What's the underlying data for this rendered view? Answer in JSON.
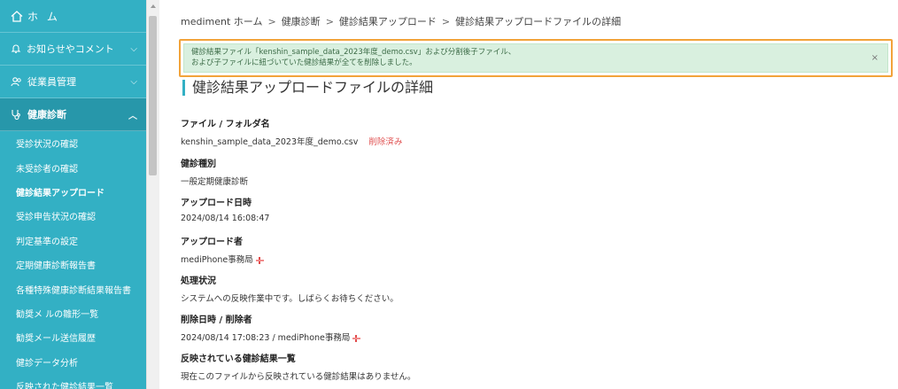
{
  "sidebar": {
    "home_label": "ホ ム",
    "sections": [
      {
        "label": "お知らせやコメント",
        "icon": "bell-icon"
      },
      {
        "label": "従業員管理",
        "icon": "users-icon"
      },
      {
        "label": "健康診断",
        "icon": "stethoscope-icon"
      }
    ],
    "sub_items": [
      {
        "label": "受診状況の確認"
      },
      {
        "label": "未受診者の確認"
      },
      {
        "label": "健診結果アップロード"
      },
      {
        "label": "受診申告状況の確認"
      },
      {
        "label": "判定基準の設定"
      },
      {
        "label": "定期健康診断報告書"
      },
      {
        "label": "各種特殊健康診断結果報告書"
      },
      {
        "label": "勧奨メ ルの雛形一覧"
      },
      {
        "label": "勧奨メール送信履歴"
      },
      {
        "label": "健診データ分析"
      },
      {
        "label": "反映された健診結果一覧"
      }
    ]
  },
  "breadcrumb": {
    "items": [
      "mediment ホーム",
      "健康診断",
      "健診結果アップロード",
      "健診結果アップロードファイルの詳細"
    ],
    "separator": ">"
  },
  "alert": {
    "line1": "健診結果ファイル「kenshin_sample_data_2023年度_demo.csv」および分割後子ファイル、",
    "line2": "および子ファイルに紐づいていた健診結果が全てを削除しました。",
    "close": "×"
  },
  "page": {
    "title": "健診結果アップロードファイルの詳細"
  },
  "fields": {
    "file": {
      "label": "ファイル / フォルダ名",
      "value": "kenshin_sample_data_2023年度_demo.csv",
      "status": "削除済み"
    },
    "type": {
      "label": "健診種別",
      "value": "一般定期健康診断"
    },
    "upload_time": {
      "label": "アップロード日時",
      "value": "2024/08/14 16:08:47"
    },
    "uploader": {
      "label": "アップロード者",
      "value": "mediPhone事務局"
    },
    "processing": {
      "label": "処理状況",
      "value": "システムへの反映作業中です。しばらくお待ちください。"
    },
    "deleted": {
      "label": "削除日時 / 削除者",
      "value": "2024/08/14 17:08:23 / mediPhone事務局"
    },
    "reflected": {
      "label": "反映されている健診結果一覧",
      "value": "現在このファイルから反映されている健診結果はありません。"
    }
  },
  "colors": {
    "sidebar": "#33b0c4",
    "sidebar_active": "#2797aa",
    "alert_bg": "#d9f0df",
    "highlight_border": "#f2a33a",
    "deleted_text": "#e05252"
  }
}
